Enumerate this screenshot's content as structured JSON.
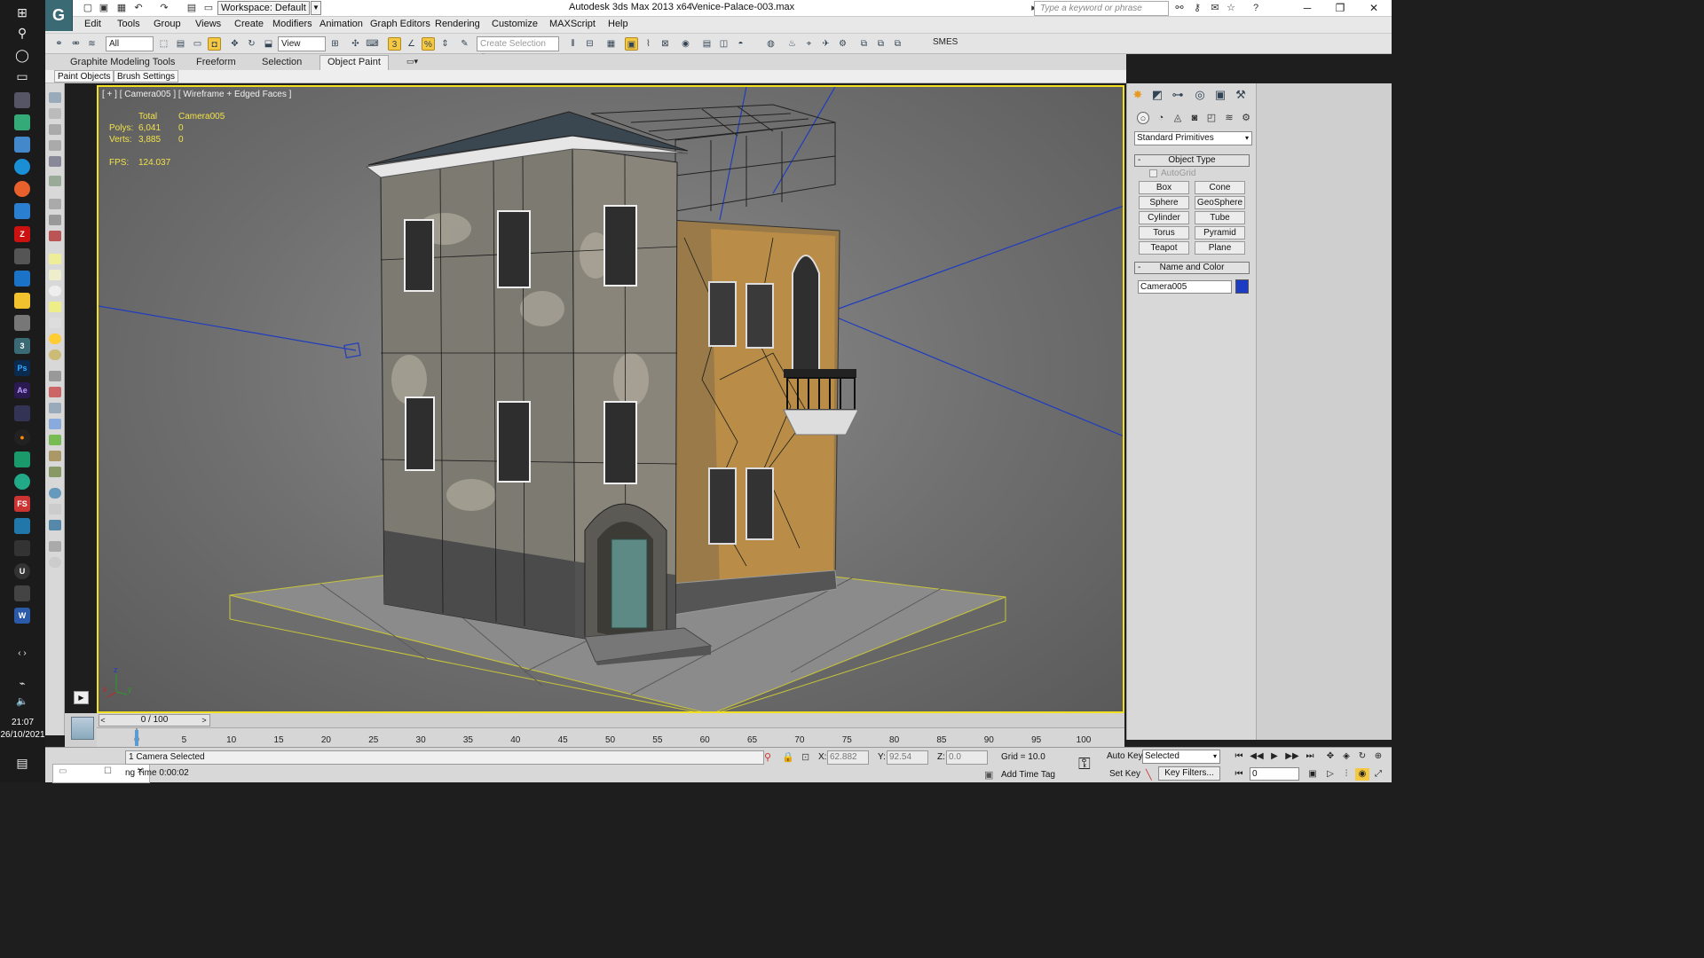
{
  "titlebar": {
    "workspace_label": "Workspace: Default",
    "app_title": "Autodesk 3ds Max  2013 x64",
    "file_name": "Venice-Palace-003.max",
    "search_placeholder": "Type a keyword or phrase"
  },
  "menu": [
    "Edit",
    "Tools",
    "Group",
    "Views",
    "Create",
    "Modifiers",
    "Animation",
    "Graph Editors",
    "Rendering",
    "Customize",
    "MAXScript",
    "Help"
  ],
  "toolbar": {
    "selection_filter": "All",
    "reference_coord": "View",
    "named_selection": "Create Selection Se",
    "smes_label": "SMES"
  },
  "ribbon": {
    "tabs": [
      "Graphite Modeling Tools",
      "Freeform",
      "Selection",
      "Object Paint"
    ],
    "active_tab": "Object Paint",
    "sub_buttons": [
      "Paint Objects",
      "Brush Settings"
    ]
  },
  "viewport": {
    "label": "[ + ] [ Camera005 ] [ Wireframe + Edged Faces ]",
    "stats": {
      "col_total": "Total",
      "col_object": "Camera005",
      "polys_label": "Polys:",
      "polys_total": "6,041",
      "polys_obj": "0",
      "verts_label": "Verts:",
      "verts_total": "3,885",
      "verts_obj": "0",
      "fps_label": "FPS:",
      "fps_value": "124.037"
    },
    "accent_color": "#f2e020"
  },
  "command_panel": {
    "category": "Standard Primitives",
    "object_type_title": "Object Type",
    "autogrid_label": "AutoGrid",
    "primitives": [
      "Box",
      "Cone",
      "Sphere",
      "GeoSphere",
      "Cylinder",
      "Tube",
      "Torus",
      "Pyramid",
      "Teapot",
      "Plane"
    ],
    "name_color_title": "Name and Color",
    "object_name": "Camera005",
    "object_color": "#1d3cc4"
  },
  "timeline": {
    "frame_display": "0 / 100",
    "ticks": [
      "0",
      "5",
      "10",
      "15",
      "20",
      "25",
      "30",
      "35",
      "40",
      "45",
      "50",
      "55",
      "60",
      "65",
      "70",
      "75",
      "80",
      "85",
      "90",
      "95",
      "100"
    ]
  },
  "status": {
    "selection_text": "1 Camera Selected",
    "prompt_text": "ng Time  0:00:02",
    "x_label": "X:",
    "x_value": "62.882",
    "y_label": "Y:",
    "y_value": "92.54",
    "z_label": "Z:",
    "z_value": "0.0",
    "grid_text": "Grid = 10.0",
    "add_time_tag": "Add Time Tag",
    "auto_key": "Auto Key",
    "set_key": "Set Key",
    "key_mode": "Selected",
    "key_filters": "Key Filters...",
    "frame_value": "0"
  },
  "taskbar": {
    "time": "21:07",
    "date": "26/10/2021"
  }
}
